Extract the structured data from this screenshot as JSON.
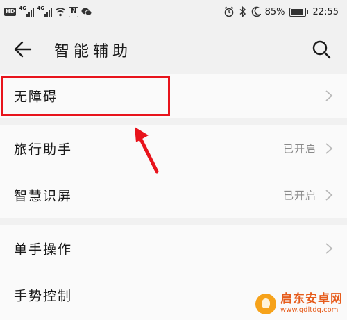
{
  "status_bar": {
    "left_badge": "HD",
    "net1": "4G",
    "net2": "4G",
    "battery_level": 0.85,
    "battery_text": "85%",
    "time": "22:55",
    "icons": [
      "alarm-icon",
      "bluetooth-icon",
      "moon-icon",
      "wifi-icon",
      "nfc-icon",
      "wechat-icon"
    ]
  },
  "header": {
    "title": "智能辅助"
  },
  "sections": {
    "accessibility": {
      "label": "无障碍"
    },
    "travel": {
      "label": "旅行助手",
      "value": "已开启"
    },
    "smart_screen": {
      "label": "智慧识屏",
      "value": "已开启"
    },
    "one_hand": {
      "label": "单手操作"
    },
    "gesture": {
      "label": "手势控制"
    }
  },
  "watermark": {
    "name": "启东安卓网",
    "url": "www.qdltdq.com"
  },
  "colors": {
    "background": "#f1f1f1",
    "card": "#fafafa",
    "annotation_red": "#e8141c",
    "secondary_text": "#8a8a8a"
  }
}
